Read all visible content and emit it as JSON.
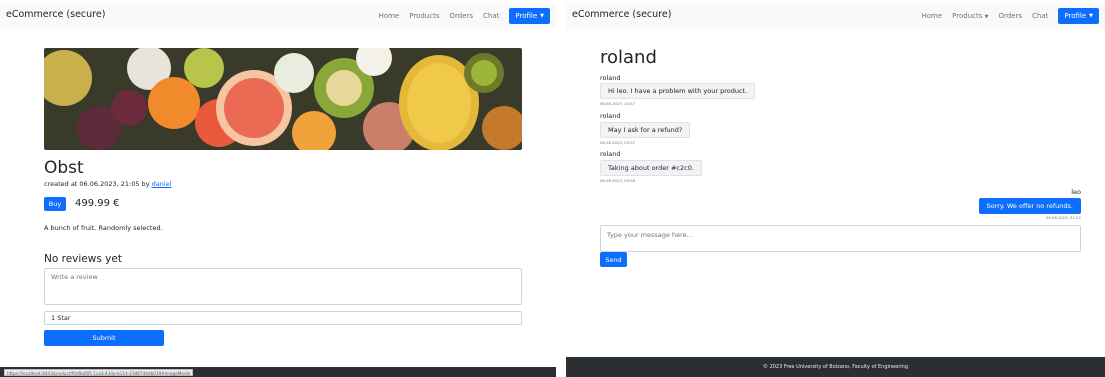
{
  "left": {
    "navbar": {
      "brand": "eCommerce (secure)",
      "links": [
        "Home",
        "Products",
        "Orders",
        "Chat"
      ],
      "profile_label": "Profile",
      "caret": "▼"
    },
    "product": {
      "title": "Obst",
      "meta_prefix": "created at 06.06.2023, 21:05 by ",
      "author": "daniel",
      "buy_label": "Buy",
      "price": "499.99 €",
      "description": "A bunch of fruit. Randomly selected."
    },
    "reviews": {
      "heading": "No reviews yet",
      "placeholder": "Write a review",
      "rating_selected": "1 Star",
      "submit_label": "Submit"
    },
    "status_url": "https://localhost:8443/product/f0d9a005-1ca3-434e-b114-23d87d4db039#imageModal"
  },
  "right": {
    "navbar": {
      "brand": "eCommerce (secure)",
      "links": [
        "Home",
        "Products",
        "Orders",
        "Chat"
      ],
      "products_caret": "▼",
      "profile_label": "Profile",
      "caret": "▼"
    },
    "chat": {
      "title": "roland",
      "messages": [
        {
          "sender": "roland",
          "text": "Hi leo. I have a problem with your product.",
          "time": "06.06.2023, 20:57"
        },
        {
          "sender": "roland",
          "text": "May I ask for a refund?",
          "time": "06.06.2023, 20:57"
        },
        {
          "sender": "roland",
          "text": "Taking about order #c2c0.",
          "time": "06.06.2023, 20:58"
        },
        {
          "sender": "leo",
          "text": "Sorry. We offer no refunds.",
          "time": "06.06.2023, 21:02"
        }
      ],
      "input_placeholder": "Type your message here...",
      "send_label": "Send"
    },
    "footer": "© 2023 Free University of Bolzano, Faculty of Engineering"
  },
  "colors": {
    "primary": "#0d6efd",
    "navbar_bg": "#f8f9fa",
    "footer_bg": "#2b2f33"
  },
  "icons": [
    "caret-down-icon",
    "resize-grip-icon"
  ]
}
